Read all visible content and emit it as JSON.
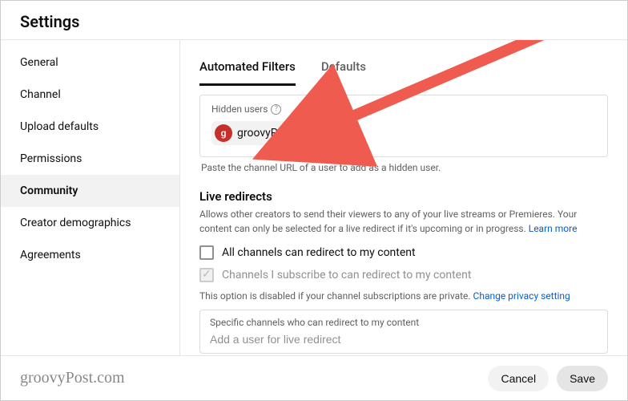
{
  "header": {
    "title": "Settings"
  },
  "sidebar": {
    "items": [
      {
        "label": "General"
      },
      {
        "label": "Channel"
      },
      {
        "label": "Upload defaults"
      },
      {
        "label": "Permissions"
      },
      {
        "label": "Community"
      },
      {
        "label": "Creator demographics"
      },
      {
        "label": "Agreements"
      }
    ]
  },
  "tabs": {
    "automated": "Automated Filters",
    "defaults": "Defaults"
  },
  "hidden_users": {
    "label": "Hidden users",
    "chip_name": "groovyPost",
    "chip_initial": "g",
    "helper": "Paste the channel URL of a user to add as a hidden user."
  },
  "live_redirects": {
    "title": "Live redirects",
    "desc": "Allows other creators to send their viewers to any of your live streams or Premieres. Your content can only be selected for a live redirect if it's upcoming or in progress. ",
    "learn_more": "Learn more",
    "check_all": "All channels can redirect to my content",
    "check_sub": "Channels I subscribe to can redirect to my content",
    "disabled_note_pre": "This option is disabled if your channel subscriptions are private. ",
    "disabled_note_link": "Change privacy setting",
    "specific_label": "Specific channels who can redirect to my content",
    "specific_placeholder": "Add a user for live redirect"
  },
  "footer": {
    "watermark": "groovyPost.com",
    "cancel": "Cancel",
    "save": "Save"
  }
}
